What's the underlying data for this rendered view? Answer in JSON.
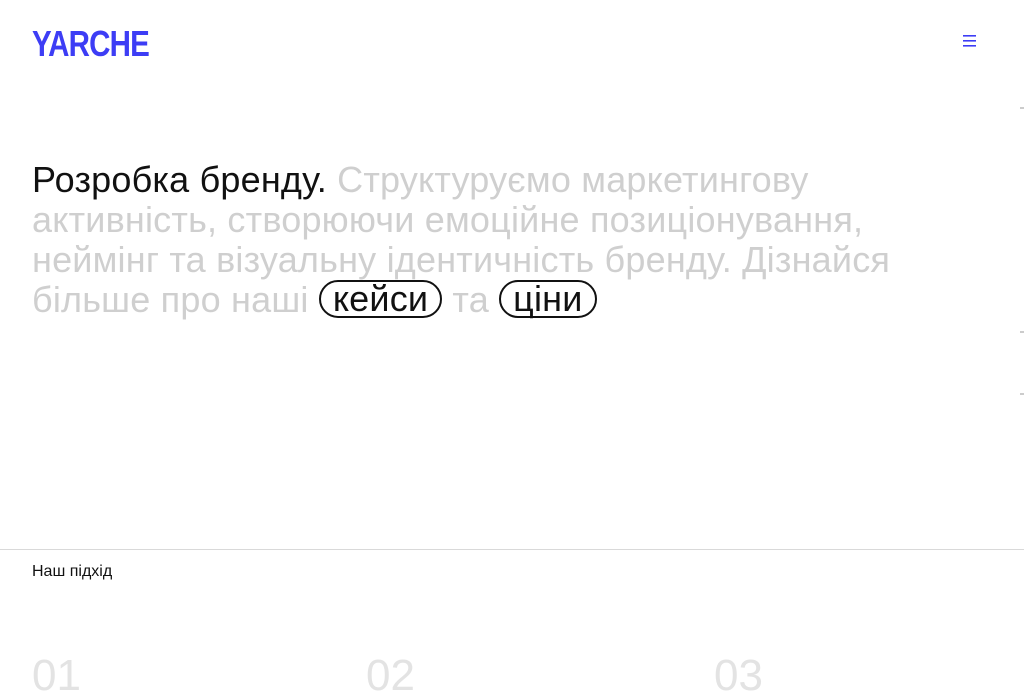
{
  "header": {
    "logo": "YARCHE",
    "menu_icon": "hamburger-icon"
  },
  "hero": {
    "lead": "Розробка бренду.",
    "body": "Структуруємо маркетингову активність, створюючи емоційне позиціонування, неймінг та візуальну ідентичність бренду. Дізнайся більше про наші",
    "link_cases": "кейси",
    "connector": "та",
    "link_prices": "ціни"
  },
  "approach": {
    "label": "Наш підхід",
    "steps": [
      "01",
      "02",
      "03"
    ]
  },
  "colors": {
    "brand": "#3d3df5",
    "text": "#111111",
    "muted": "#cfcfcf"
  }
}
